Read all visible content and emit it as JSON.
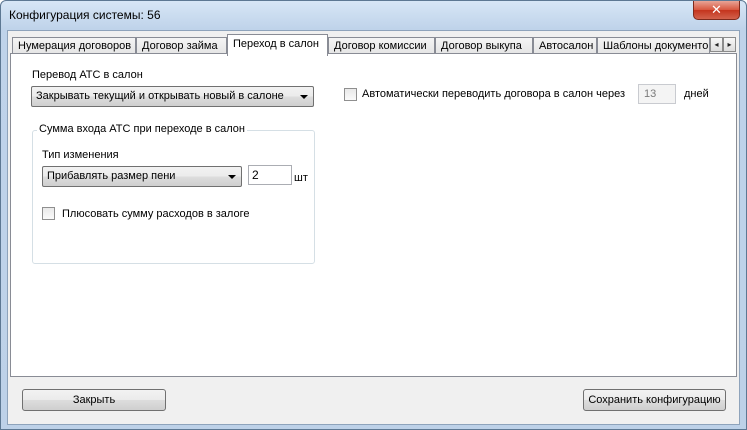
{
  "window": {
    "title": "Конфигурация системы: 56",
    "close_glyph": "✕"
  },
  "tabs": [
    {
      "label": "Нумерация договоров"
    },
    {
      "label": "Договор займа"
    },
    {
      "label": "Переход в салон",
      "active": true
    },
    {
      "label": "Договор комиссии"
    },
    {
      "label": "Договор выкупа"
    },
    {
      "label": "Автосалон"
    },
    {
      "label": "Шаблоны документов"
    }
  ],
  "tab_scroll": {
    "left_glyph": "◂",
    "right_glyph": "▸"
  },
  "transfer": {
    "label": "Перевод АТС в салон",
    "selected": "Закрывать текущий и открывать новый в салоне"
  },
  "auto_transfer": {
    "label": "Автоматически переводить договора в салон через",
    "checked": false,
    "days_value": "13",
    "days_unit": "дней"
  },
  "entry_sum_group": {
    "caption": "Сумма входа АТС при переходе в салон",
    "change_type_label": "Тип изменения",
    "change_type_selected": "Прибавлять размер пени",
    "count_value": "2",
    "count_unit": "шт",
    "add_expenses_label": "Плюсовать сумму расходов в залоге",
    "add_expenses_checked": false
  },
  "footer": {
    "close_label": "Закрыть",
    "save_label": "Сохранить конфигурацию"
  }
}
